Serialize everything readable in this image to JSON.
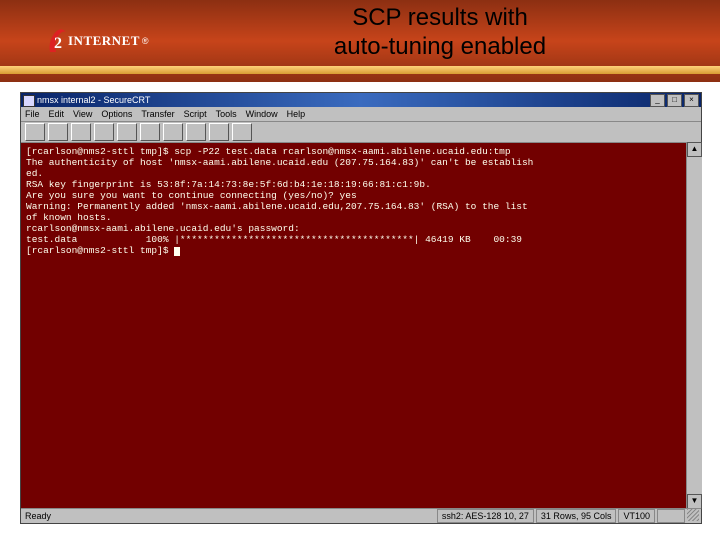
{
  "slide": {
    "logo_text": "INTERNET",
    "logo_reg": "®",
    "title_l1": "SCP results with",
    "title_l2": "auto-tuning enabled"
  },
  "window": {
    "title": "nmsx internal2 - SecureCRT",
    "minimize": "_",
    "maximize": "□",
    "close": "×"
  },
  "menu": {
    "file": "File",
    "edit": "Edit",
    "view": "View",
    "options": "Options",
    "transfer": "Transfer",
    "script": "Script",
    "tools": "Tools",
    "window": "Window",
    "help": "Help"
  },
  "terminal": {
    "lines": [
      "[rcarlson@nms2-sttl tmp]$ scp -P22 test.data rcarlson@nmsx-aami.abilene.ucaid.edu:tmp",
      "The authenticity of host 'nmsx-aami.abilene.ucaid.edu (207.75.164.83)' can't be establish",
      "ed.",
      "RSA key fingerprint is 53:8f:7a:14:73:8e:5f:6d:b4:1e:18:19:66:81:c1:9b.",
      "Are you sure you want to continue connecting (yes/no)? yes",
      "Warning: Permanently added 'nmsx-aami.abilene.ucaid.edu,207.75.164.83' (RSA) to the list",
      "of known hosts.",
      "rcarlson@nmsx-aami.abilene.ucaid.edu's password:",
      "test.data            100% |*****************************************| 46419 KB    00:39",
      "[rcarlson@nms2-sttl tmp]$ "
    ]
  },
  "status": {
    "left": "Ready",
    "cipher": "ssh2: AES-128  10, 27",
    "rows": "31 Rows, 95 Cols",
    "mode": "VT100"
  },
  "colors": {
    "terminal_bg": "#720000",
    "terminal_fg": "#ffffee",
    "banner_grad_dark": "#8c2f12",
    "banner_grad_light": "#c7441a"
  }
}
